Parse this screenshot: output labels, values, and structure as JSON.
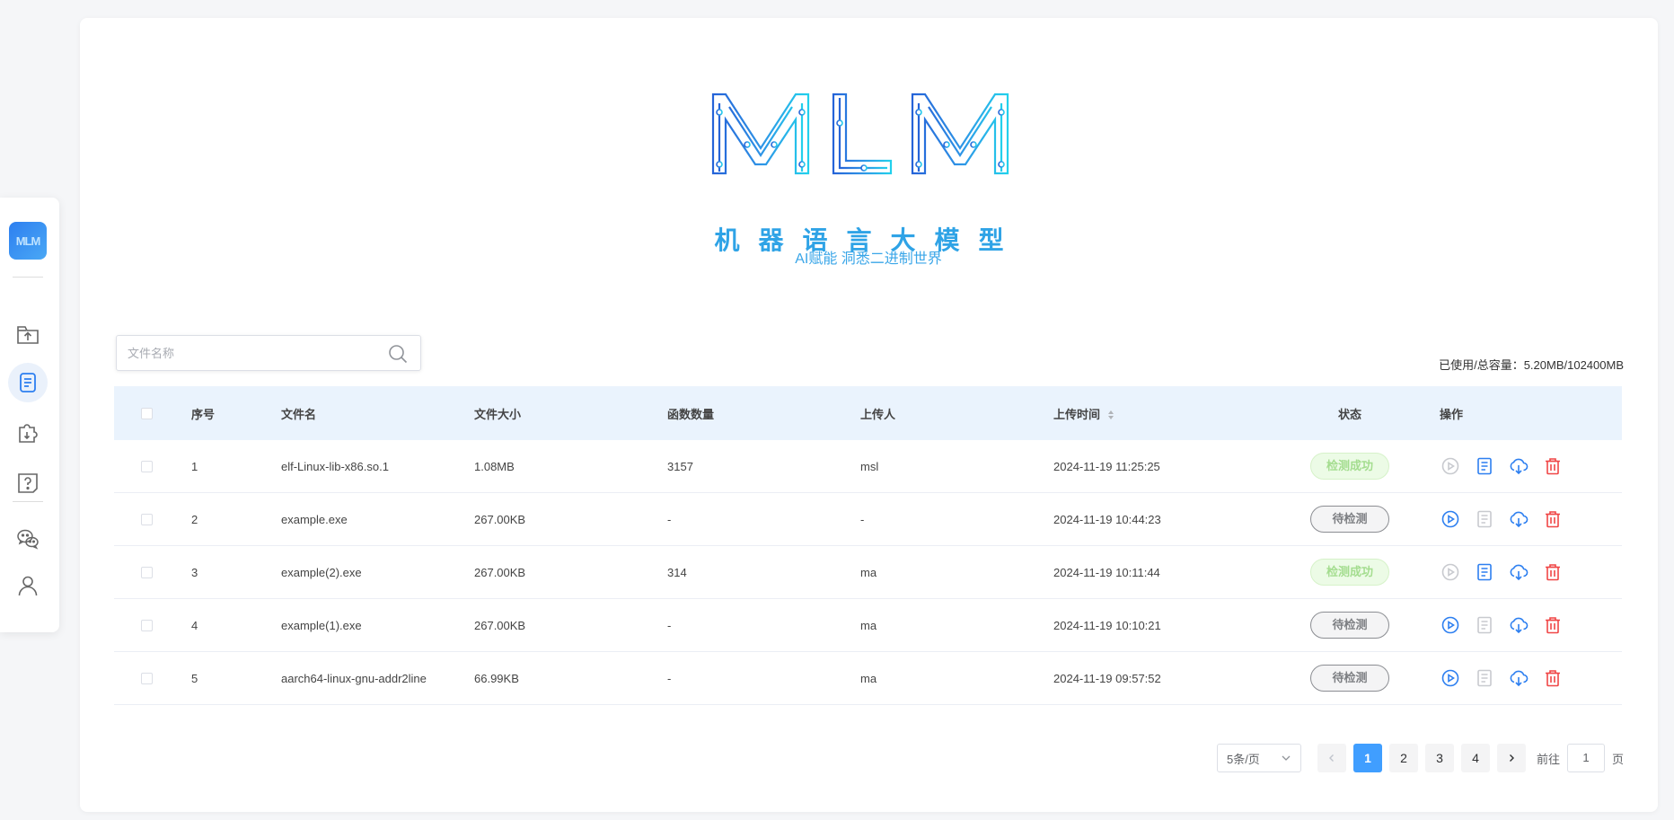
{
  "sidebar": {
    "logo_text": "MLM",
    "items": [
      {
        "name": "upload-folder-icon"
      },
      {
        "name": "document-list-icon",
        "active": true
      },
      {
        "name": "plugin-download-icon"
      },
      {
        "name": "help-icon"
      },
      {
        "name": "wechat-icon"
      },
      {
        "name": "user-icon"
      }
    ]
  },
  "hero": {
    "logo_text": "MLM",
    "subtitle": "机器语言大模型",
    "tagline": "AI赋能 洞悉二进制世界"
  },
  "search": {
    "placeholder": "文件名称"
  },
  "capacity": "已使用/总容量：5.20MB/102400MB",
  "table": {
    "headers": [
      "序号",
      "文件名",
      "文件大小",
      "函数数量",
      "上传人",
      "上传时间",
      "状态",
      "操作"
    ],
    "rows": [
      {
        "idx": "1",
        "name": "elf-Linux-lib-x86.so.1",
        "size": "1.08MB",
        "funcs": "3157",
        "user": "msl",
        "time": "2024-11-19 11:25:25",
        "status": "检测成功",
        "status_type": "ok"
      },
      {
        "idx": "2",
        "name": "example.exe",
        "size": "267.00KB",
        "funcs": "-",
        "user": "-",
        "time": "2024-11-19 10:44:23",
        "status": "待检测",
        "status_type": "wait"
      },
      {
        "idx": "3",
        "name": "example(2).exe",
        "size": "267.00KB",
        "funcs": "314",
        "user": "ma",
        "time": "2024-11-19 10:11:44",
        "status": "检测成功",
        "status_type": "ok"
      },
      {
        "idx": "4",
        "name": "example(1).exe",
        "size": "267.00KB",
        "funcs": "-",
        "user": "ma",
        "time": "2024-11-19 10:10:21",
        "status": "待检测",
        "status_type": "wait"
      },
      {
        "idx": "5",
        "name": "aarch64-linux-gnu-addr2line",
        "size": "66.99KB",
        "funcs": "-",
        "user": "ma",
        "time": "2024-11-19 09:57:52",
        "status": "待检测",
        "status_type": "wait"
      }
    ]
  },
  "pagination": {
    "page_size": "5条/页",
    "pages": [
      "1",
      "2",
      "3",
      "4"
    ],
    "current": "1",
    "goto_label": "前往",
    "goto_value": "1",
    "page_unit": "页"
  },
  "colors": {
    "accent": "#409eff",
    "brand_blue": "#2d7ff0",
    "brand_cyan": "#22c6ea",
    "success": "#a4dd8f",
    "danger": "#f04747"
  }
}
